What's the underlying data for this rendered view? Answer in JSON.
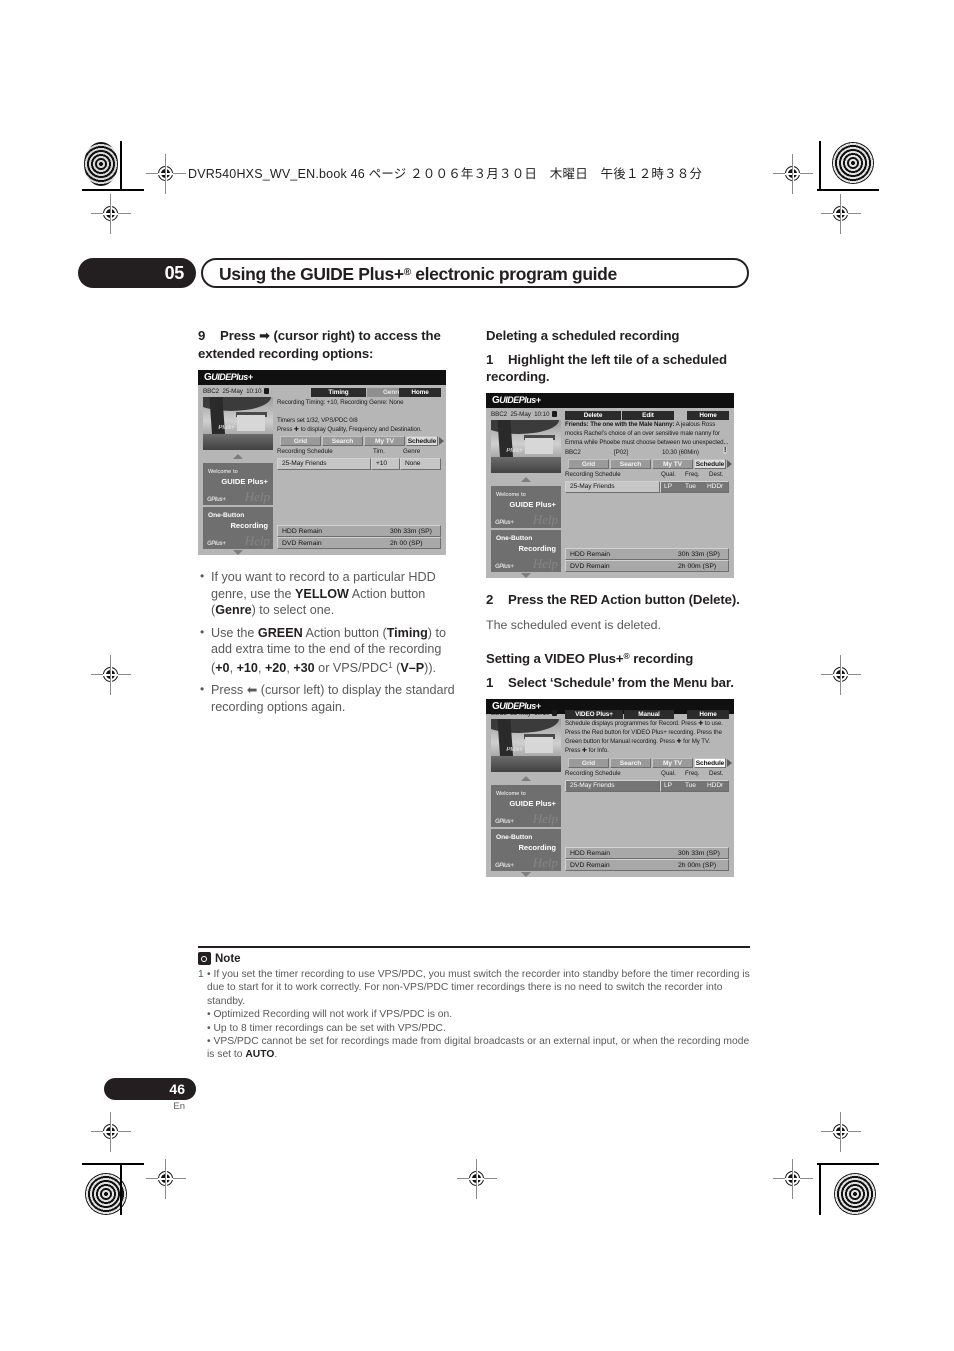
{
  "header": {
    "book_line": "DVR540HXS_WV_EN.book  46 ページ  ２００６年３月３０日　木曜日　午後１２時３８分"
  },
  "chapter": {
    "number": "05",
    "title_pre": "Using the GUIDE Plus+",
    "title_reg": "®",
    "title_post": " electronic program guide"
  },
  "left_column": {
    "step9": {
      "num": "9",
      "text_a": "Press ",
      "arrow": "➡",
      "text_b": " (cursor right) to access the extended recording options:"
    },
    "bullets": [
      {
        "parts": [
          {
            "t": "If you want to record to a particular HDD genre, use the ",
            "b": false
          },
          {
            "t": "YELLOW",
            "b": true
          },
          {
            "t": " Action button (",
            "b": false
          },
          {
            "t": "Genre",
            "b": true
          },
          {
            "t": ") to select one.",
            "b": false
          }
        ]
      },
      {
        "parts": [
          {
            "t": "Use the ",
            "b": false
          },
          {
            "t": "GREEN",
            "b": true
          },
          {
            "t": " Action button (",
            "b": false
          },
          {
            "t": "Timing",
            "b": true
          },
          {
            "t": ") to add extra time to the end of the recording (",
            "b": false
          },
          {
            "t": "+0",
            "b": true
          },
          {
            "t": ", ",
            "b": false
          },
          {
            "t": "+10",
            "b": true
          },
          {
            "t": ", ",
            "b": false
          },
          {
            "t": "+20",
            "b": true
          },
          {
            "t": ", ",
            "b": false
          },
          {
            "t": "+30",
            "b": true
          },
          {
            "t": " or VPS/PDC",
            "b": false
          },
          {
            "t": "1",
            "sup": true
          },
          {
            "t": " (",
            "b": false
          },
          {
            "t": "V–P",
            "b": true
          },
          {
            "t": ")).",
            "b": false
          }
        ]
      },
      {
        "parts": [
          {
            "t": "Press ",
            "b": false
          },
          {
            "t": "⬅",
            "b": false
          },
          {
            "t": " (cursor left) to display the standard recording options again.",
            "b": false
          }
        ]
      }
    ]
  },
  "right_column": {
    "heading_delete": "Deleting a scheduled recording",
    "step1_delete": {
      "num": "1",
      "text": "Highlight the left tile of a scheduled recording."
    },
    "step2_delete": {
      "num": "2",
      "text": "Press the RED Action button (Delete).",
      "sub": "The scheduled event is deleted."
    },
    "heading_videoplus_pre": "Setting a VIDEO Plus+",
    "heading_videoplus_reg": "®",
    "heading_videoplus_post": " recording",
    "step1_videoplus": {
      "num": "1",
      "text": "Select ‘Schedule’ from the Menu bar."
    }
  },
  "screenshot1": {
    "logo": "GUIDE Plus+",
    "channel": "BBC2",
    "date": "25-May",
    "time": "10:10",
    "action_buttons": [
      {
        "label": "Timing",
        "style": "dark"
      },
      {
        "label": "Genre",
        "style": "mid"
      },
      {
        "label": "Home",
        "style": "dark"
      }
    ],
    "desc_lines": [
      "Recording Timing: +10, Recording Genre: None",
      "",
      "Timers set 1/32, VPS/PDC 0/8",
      "Press ✚ to display Quality, Frequency and Destination."
    ],
    "nav": [
      {
        "label": "Grid",
        "sel": false
      },
      {
        "label": "Search",
        "sel": false
      },
      {
        "label": "My TV",
        "sel": false
      },
      {
        "label": "Schedule",
        "sel": true
      }
    ],
    "schedule_label": "Recording Schedule",
    "col_headers": [
      "Tim.",
      "Genre"
    ],
    "schedule_row": {
      "title": "25-May  Friends",
      "values": [
        "+10",
        "None"
      ]
    },
    "tiles": [
      {
        "line1": "Welcome",
        "line1_small": "to",
        "line2": "GUIDE Plus+"
      },
      {
        "line1": "One-Button",
        "line2": "Recording"
      }
    ],
    "remain": [
      {
        "label": "HDD Remain",
        "value": "30h 33m (SP)"
      },
      {
        "label": "DVD Remain",
        "value": "2h 00 (SP)"
      }
    ]
  },
  "screenshot2": {
    "logo": "GUIDE Plus+",
    "channel": "BBC2",
    "date": "25-May",
    "time": "10:10",
    "action_buttons": [
      {
        "label": "Delete",
        "style": "dark"
      },
      {
        "label": "Edit",
        "style": "dark"
      },
      {
        "label": "Home",
        "style": "dark"
      }
    ],
    "title_bold": "Friends: The one with the Male Nanny:",
    "desc_lines": [
      " A jealous Ross",
      "mocks Rachel’s choice of an over sensitive male nanny for",
      "Emma while Phoebe must choose between two unexpected..."
    ],
    "meta": {
      "channel": "BBC2",
      "code": "[P02]",
      "time": "10.30 (60Min)",
      "flag": "!"
    },
    "nav": [
      {
        "label": "Grid",
        "sel": false
      },
      {
        "label": "Search",
        "sel": false
      },
      {
        "label": "My TV",
        "sel": false
      },
      {
        "label": "Schedule",
        "sel": true
      }
    ],
    "schedule_label": "Recording Schedule",
    "col_headers": [
      "Qual.",
      "Freq.",
      "Dest."
    ],
    "schedule_row": {
      "title": "25-May  Friends",
      "values": [
        "LP",
        "Tue",
        "HDDr"
      ]
    },
    "tiles": [
      {
        "line1": "Welcome",
        "line1_small": "to",
        "line2": "GUIDE Plus+"
      },
      {
        "line1": "One-Button",
        "line2": "Recording"
      }
    ],
    "remain": [
      {
        "label": "HDD Remain",
        "value": "30h 33m (SP)"
      },
      {
        "label": "DVD Remain",
        "value": "2h 00m (SP)"
      }
    ]
  },
  "screenshot3": {
    "logo": "GUIDE Plus+",
    "channel": "BBC2",
    "date": "25-May",
    "time": "10:10",
    "action_buttons": [
      {
        "label": "VIDEO Plus+",
        "style": "dark"
      },
      {
        "label": "Manual",
        "style": "dark"
      },
      {
        "label": "Home",
        "style": "dark"
      }
    ],
    "desc_lines": [
      "Schedule displays programmes for Record. Press ✚ to use.",
      "Press the Red button for VIDEO Plus+ recording. Press the",
      "Green button for Manual recording. Press ✚ for My TV.",
      "Press ✚ for Info."
    ],
    "nav": [
      {
        "label": "Grid",
        "sel": false
      },
      {
        "label": "Search",
        "sel": false
      },
      {
        "label": "My TV",
        "sel": false
      },
      {
        "label": "Schedule",
        "sel": true
      }
    ],
    "schedule_label": "Recording Schedule",
    "col_headers": [
      "Qual.",
      "Freq.",
      "Dest."
    ],
    "schedule_row": {
      "title": "25-May  Friends",
      "values": [
        "LP",
        "Tue",
        "HDDr"
      ]
    },
    "tiles": [
      {
        "line1": "Welcome",
        "line1_small": "to",
        "line2": "GUIDE Plus+"
      },
      {
        "line1": "One-Button",
        "line2": "Recording"
      }
    ],
    "remain": [
      {
        "label": "HDD Remain",
        "value": "30h 33m (SP)"
      },
      {
        "label": "DVD Remain",
        "value": "2h 00m (SP)"
      }
    ]
  },
  "note": {
    "title": "Note",
    "footnote_marker": "1",
    "line1": "• If you set the timer recording to use VPS/PDC, you must switch the recorder into standby before the timer recording is due to start for it to work correctly. For non-VPS/PDC timer recordings there is no need to switch the recorder into standby.",
    "bullet2": "• Optimized Recording will not work if VPS/PDC is on.",
    "bullet3": "• Up to 8 timer recordings can be set with VPS/PDC.",
    "bullet4_a": "• VPS/PDC cannot be set for recordings made from digital broadcasts or an external input, or when the recording mode is set to ",
    "bullet4_b": "AUTO",
    "bullet4_c": "."
  },
  "footer": {
    "page_number": "46",
    "language": "En"
  }
}
